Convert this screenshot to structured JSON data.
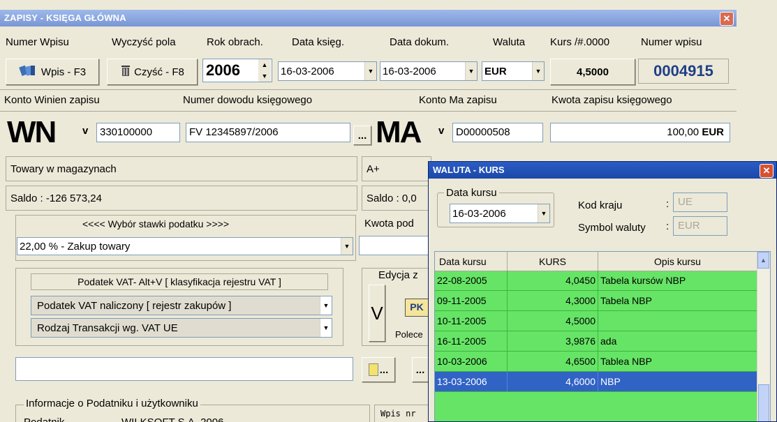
{
  "window": {
    "title": "ZAPISY - KSIĘGA GŁÓWNA"
  },
  "headers": {
    "numer_wpisu": "Numer Wpisu",
    "wyczysc": "Wyczyść pola",
    "rok": "Rok obrach.",
    "data_ksieg": "Data księg.",
    "data_dokum": "Data dokum.",
    "waluta": "Waluta",
    "kurs": "Kurs  /#.0000",
    "numer_wpisu2": "Numer wpisu"
  },
  "toolbar": {
    "wpis_label": "Wpis - F3",
    "czysc_label": "Czyść - F8",
    "year": "2006",
    "data_ksieg": "16-03-2006",
    "data_dokum": "16-03-2006",
    "waluta": "EUR",
    "kurs": "4,5000",
    "numer": "0004915"
  },
  "row2": {
    "konto_winien": "Konto  Winien  zapisu",
    "numer_dowodu": "Numer dowodu księgowego",
    "konto_ma": "Konto   Ma   zapisu",
    "kwota_label": "Kwota zapisu księgowego"
  },
  "entry": {
    "wn": "WN",
    "v1": "v",
    "konto_wn": "330100000",
    "dowod": "FV 12345897/2006",
    "dots": "...",
    "ma": "MA",
    "v2": "v",
    "konto_ma": "D00000508",
    "kwota": "100,00",
    "kwota_cur": "EUR"
  },
  "info": {
    "wn_name": "Towary w magazynach",
    "ma_name": "A+",
    "saldo_wn": "Saldo : -126 573,24",
    "saldo_ma": "Saldo : 0,0",
    "stawka_header": "<<<<  Wybór stawki podatku  >>>>",
    "stawka_value": "22,00 %  -  Zakup towary",
    "kwota_pod": "Kwota pod"
  },
  "vat": {
    "group_title": "Podatek VAT- Alt+V [ klasyfikacja rejestru VAT ]",
    "rejestr": "Podatek VAT naliczony [ rejestr zakupów ]",
    "transakcja": "Rodzaj Transakcji wg. VAT UE",
    "edycja": "Edycja z",
    "v_btn": "V",
    "pk": "PK",
    "polece": "Polece"
  },
  "bottom": {
    "info_group": "Informacje o Podatniku i użytkowniku",
    "podatnik": "Podatnik",
    "podatnik_val": "WILKSOFT S.A.   2006",
    "wpis_nr": "Wpis nr",
    "dots2": "...",
    "dots3": "..."
  },
  "popup": {
    "title": "WALUTA - KURS",
    "data_kursu_label": "Data kursu",
    "data_kursu_value": "16-03-2006",
    "kod_kraju_label": "Kod kraju",
    "kod_kraju_value": "UE",
    "symbol_label": "Symbol waluty",
    "symbol_value": "EUR",
    "columns": [
      "Data kursu",
      "KURS",
      "Opis kursu"
    ],
    "rows": [
      {
        "date": "22-08-2005",
        "kurs": "4,0450",
        "opis": "Tabela kursów NBP"
      },
      {
        "date": "09-11-2005",
        "kurs": "4,3000",
        "opis": "Tabela NBP"
      },
      {
        "date": "10-11-2005",
        "kurs": "4,5000",
        "opis": ""
      },
      {
        "date": "16-11-2005",
        "kurs": "3,9876",
        "opis": "ada"
      },
      {
        "date": "10-03-2006",
        "kurs": "4,6500",
        "opis": "Tablea NBP"
      },
      {
        "date": "13-03-2006",
        "kurs": "4,6000",
        "opis": "NBP"
      }
    ],
    "selected_row": 5
  }
}
